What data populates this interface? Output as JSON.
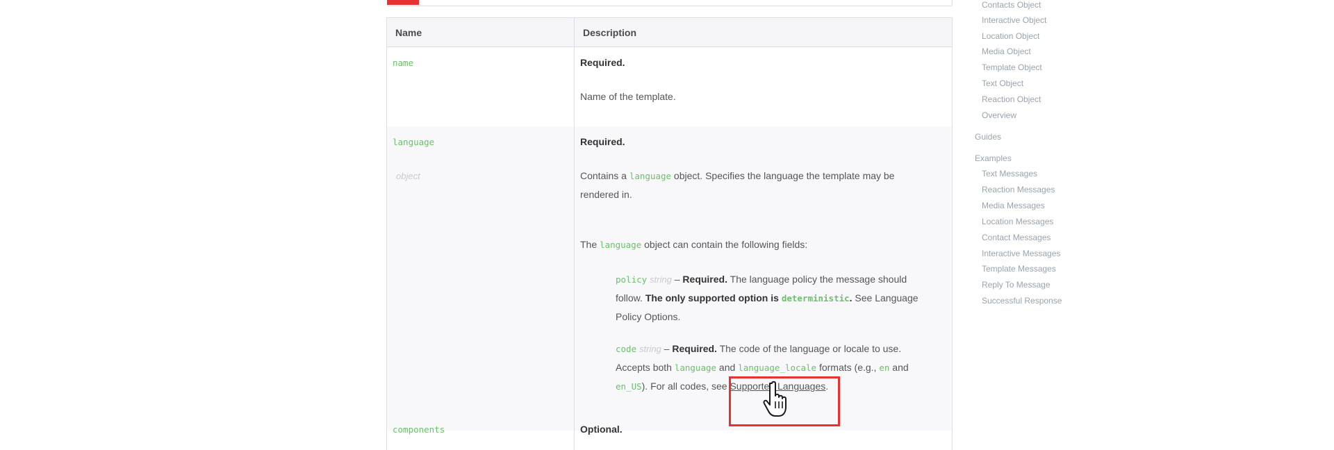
{
  "table": {
    "headers": {
      "name": "Name",
      "description": "Description"
    },
    "rows": {
      "name": {
        "param": "name",
        "required": "Required.",
        "desc": "Name of the template."
      },
      "language": {
        "param": "language",
        "type": "object",
        "required": "Required.",
        "desc_pre": "Contains a ",
        "desc_code": "language",
        "desc_post_line1": " object. Specifies the language the template may be",
        "desc_line2": "rendered in.",
        "fields_pre": "The ",
        "fields_code": "language",
        "fields_post": " object can contain the following fields:",
        "policy": {
          "field": "policy",
          "type": "string",
          "dash": " – ",
          "required": "Required.",
          "text1": " The language policy the message should",
          "text2a": "follow. ",
          "bold2": "The only supported option is ",
          "code2": "deterministic",
          "bold2b": ".",
          "text2c": " See Language",
          "text3": "Policy Options."
        },
        "code": {
          "field": "code",
          "type": "string",
          "dash": " – ",
          "required": "Required.",
          "text1": " The code of the language or locale to use.",
          "text2a": "Accepts both ",
          "code2a": "language",
          "text2b": " and ",
          "code2b": "language_locale",
          "text2c": " formats (e.g., ",
          "code2c": "en",
          "text2d": " and",
          "code3a": "en_US",
          "text3a": "). For all codes, see ",
          "link3": "Supported Languages",
          "text3b": "."
        }
      },
      "components": {
        "param": "components",
        "required": "Optional."
      }
    }
  },
  "sidebar": {
    "items": [
      "Contacts Object",
      "Interactive Object",
      "Location Object",
      "Media Object",
      "Template Object",
      "Text Object",
      "Reaction Object",
      "Overview",
      "Guides",
      "Examples",
      "Text Messages",
      "Reaction Messages",
      "Media Messages",
      "Location Messages",
      "Contact Messages",
      "Interactive Messages",
      "Template Messages",
      "Reply To Message",
      "Successful Response"
    ]
  },
  "colors": {
    "code": "#6cbf6a",
    "highlight": "#e8322f",
    "sidebar_text": "#9aa3ad"
  },
  "icons": {
    "cursor": "hand-pointer-icon"
  }
}
